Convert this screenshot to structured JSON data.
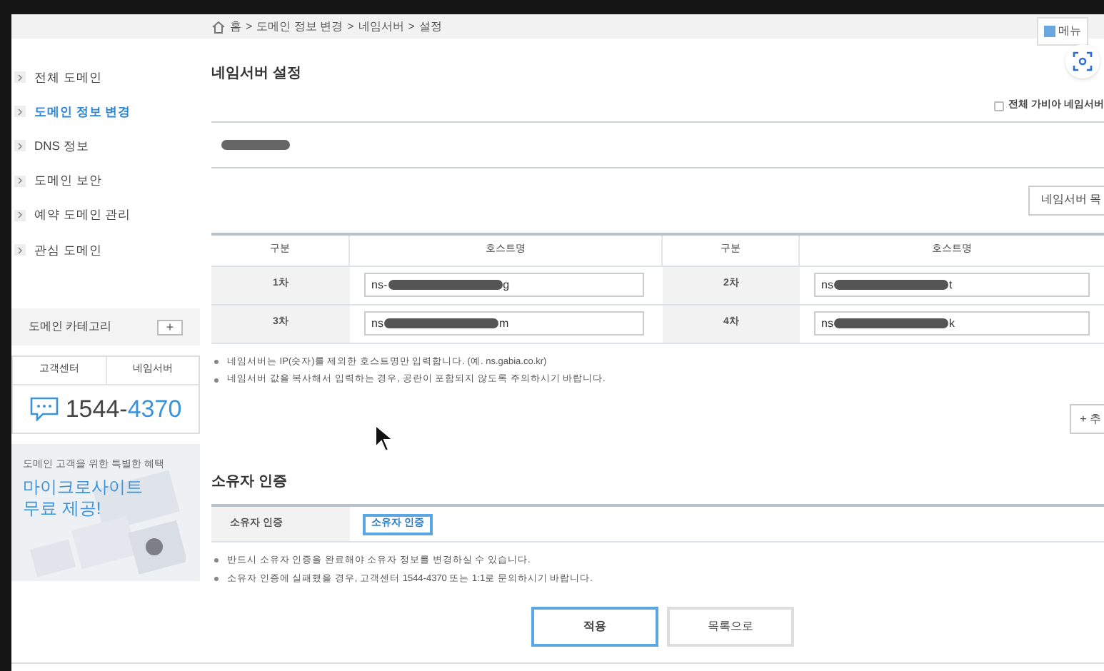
{
  "breadcrumb": [
    "홈",
    "도메인 정보 변경",
    "네임서버",
    "설정"
  ],
  "breadcrumb_separator": ">",
  "top_button": {
    "label": "메뉴"
  },
  "sidebar": {
    "items": [
      {
        "label": "전체 도메인",
        "selected": false
      },
      {
        "label": "도메인 정보 변경",
        "selected": true
      },
      {
        "label": "DNS 정보",
        "selected": false
      },
      {
        "label": "도메인 보안",
        "selected": false
      },
      {
        "label": "예약 도메인 관리",
        "selected": false
      },
      {
        "label": "관심 도메인",
        "selected": false
      }
    ],
    "category": {
      "label": "도메인 카테고리",
      "button": "+"
    },
    "support": {
      "tabs": [
        "고객센터",
        "네임서버"
      ],
      "phone_prefix": "1544-",
      "phone_suffix": "4370"
    },
    "promo": {
      "subtitle": "도메인 고객을 위한 특별한 혜택",
      "title_lines": [
        "마이크로사이트",
        "무료 제공!"
      ]
    }
  },
  "nameserver": {
    "title": "네임서버 설정",
    "all_gabia": {
      "label": "전체 가비아 네임서버",
      "checked": false
    },
    "domain": {
      "redacted": true
    },
    "list_button": "네임서버 목",
    "columns": [
      "구분",
      "호스트명",
      "구분",
      "호스트명"
    ],
    "rows": [
      [
        {
          "label": "1차",
          "start": "ns-",
          "end": "g"
        },
        {
          "label": "2차",
          "start": "ns",
          "end": "t"
        }
      ],
      [
        {
          "label": "3차",
          "start": "ns",
          "end": "m"
        },
        {
          "label": "4차",
          "start": "ns",
          "end": "k"
        }
      ]
    ],
    "notes": [
      "네임서버는 IP(숫자)를 제외한 호스트명만 입력합니다. (예. ns.gabia.co.kr)",
      "네임서버 값을 복사해서 입력하는 경우, 공란이 포함되지 않도록 주의하시기 바랍니다."
    ],
    "add_button": "+ 추"
  },
  "owner": {
    "title": "소유자 인증",
    "row_label": "소유자 인증",
    "button": "소유자 인증",
    "notes": [
      "반드시 소유자 인증을 완료해야 소유자 정보를 변경하실 수 있습니다.",
      "소유자 인증에 실패했을 경우, 고객센터 1544-4370 또는 1:1로 문의하시기 바랍니다."
    ]
  },
  "actions": [
    {
      "label": "적용",
      "kind": "primary"
    },
    {
      "label": "목록으로",
      "kind": "secondary"
    }
  ]
}
